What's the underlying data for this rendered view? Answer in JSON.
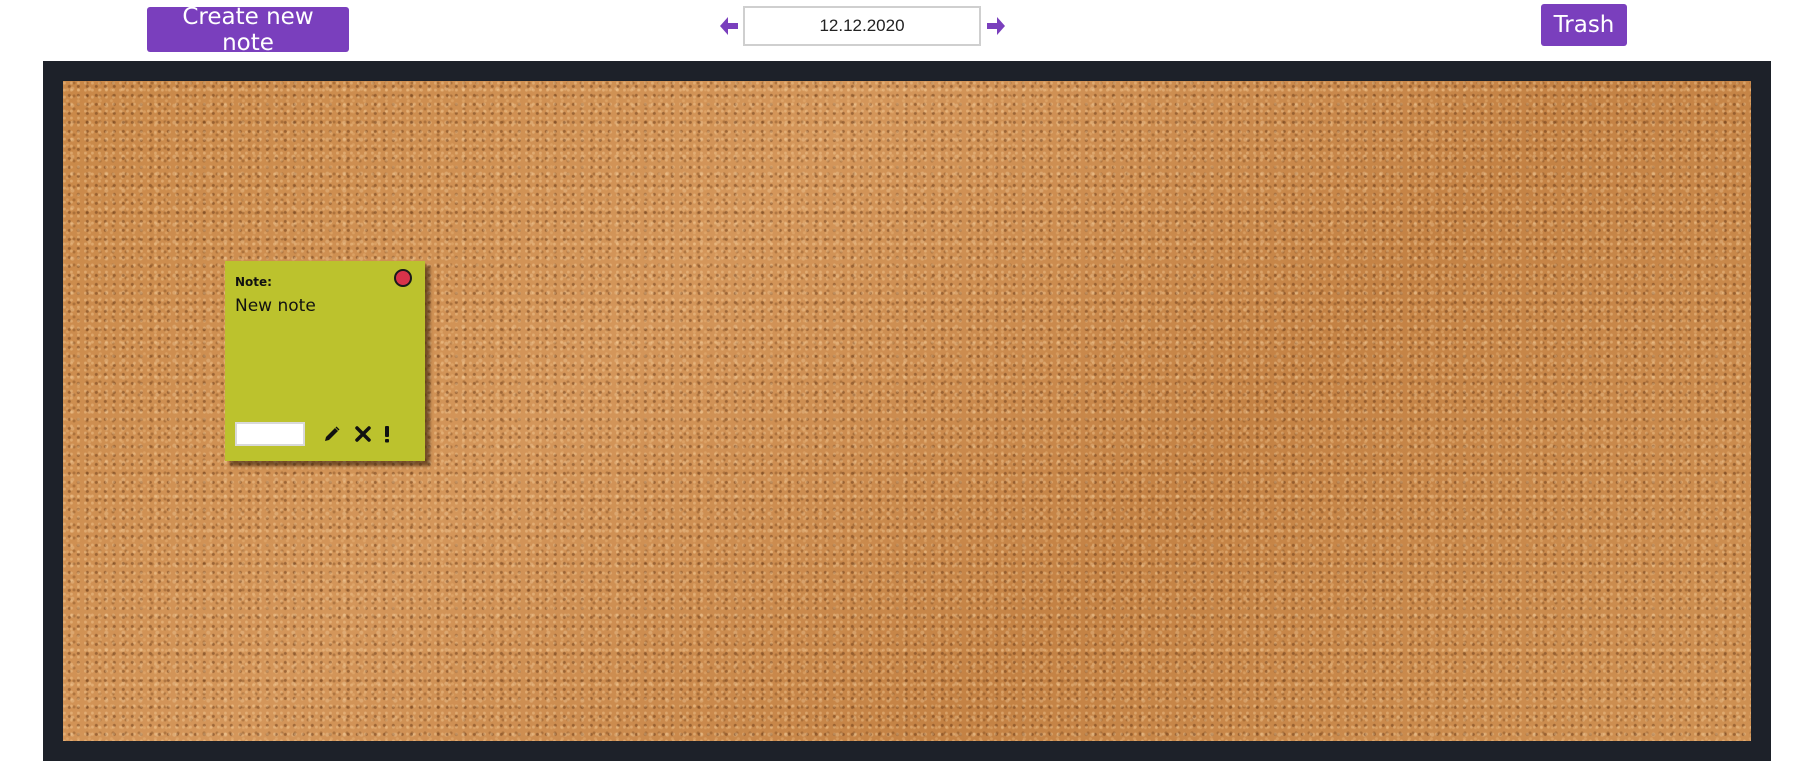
{
  "toolbar": {
    "create_label": "Create new note",
    "trash_label": "Trash",
    "date_value": "12.12.2020",
    "prev_icon": "arrow-left-icon",
    "next_icon": "arrow-right-icon"
  },
  "board": {
    "frame_color": "#1d2129",
    "cork_color": "#c98a4c"
  },
  "notes": [
    {
      "label": "Note:",
      "text": "New note",
      "color": "#bcc22d",
      "pin_color": "#d8334a",
      "input_value": "",
      "icons": [
        "pencil-icon",
        "close-icon",
        "exclamation-icon"
      ]
    }
  ],
  "colors": {
    "accent": "#7a3fbd"
  }
}
